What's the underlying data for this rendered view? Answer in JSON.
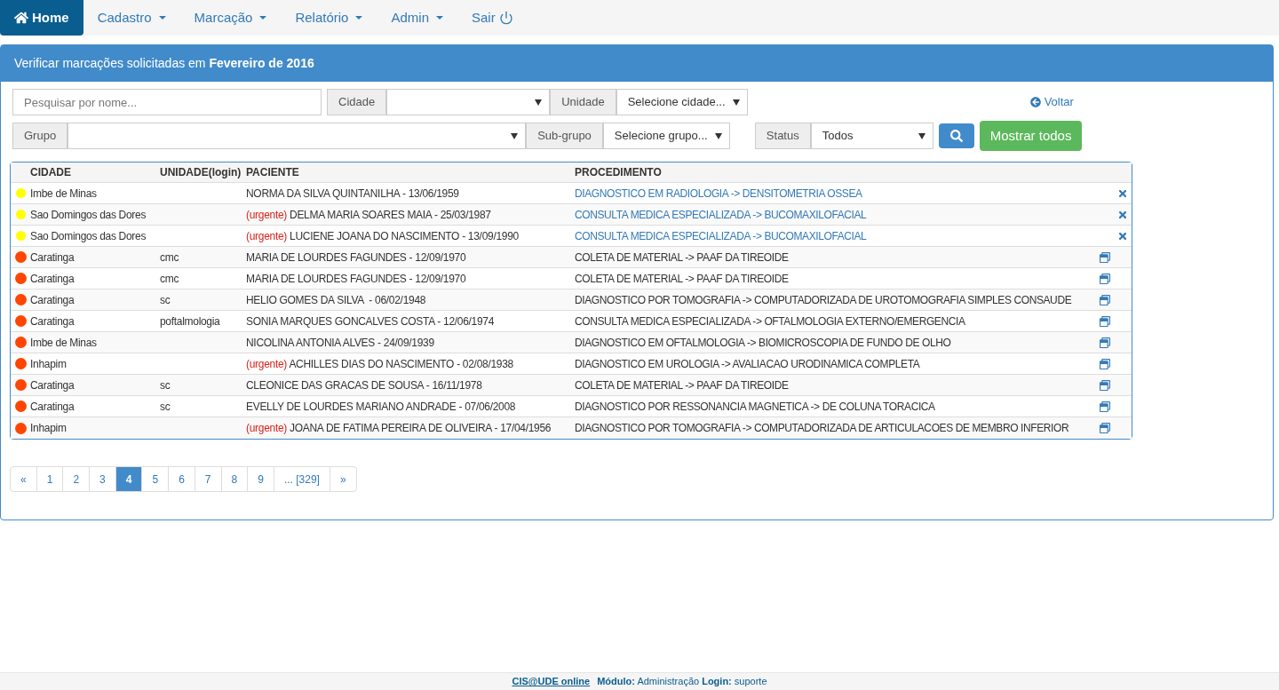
{
  "nav": {
    "items": [
      {
        "label": "Home",
        "kind": "home",
        "selected": true
      },
      {
        "label": "Cadastro",
        "kind": "dropdown",
        "selected": false
      },
      {
        "label": "Marcação",
        "kind": "dropdown",
        "selected": false
      },
      {
        "label": "Relatório",
        "kind": "dropdown",
        "selected": false
      },
      {
        "label": "Admin",
        "kind": "dropdown",
        "selected": false
      },
      {
        "label": "Sair",
        "kind": "logout",
        "selected": false
      }
    ]
  },
  "panel": {
    "title": "Verificar marcações solicitadas em **Fevereiro de 2016**"
  },
  "filters": {
    "search": {
      "placeholder": "Pesquisar por nome..."
    },
    "cidade": {
      "label": "Cidade"
    },
    "unidade": {
      "label": "Unidade",
      "value": "Selecione cidade..."
    },
    "voltar": "Voltar",
    "grupo": {
      "label": "Grupo"
    },
    "subgrupo": {
      "label": "Sub-grupo",
      "value": "Selecione grupo..."
    },
    "status": {
      "label": "Status",
      "value": "Todos"
    },
    "show_all": "Mostrar todos"
  },
  "table": {
    "columns": [
      "CIDADE",
      "UNIDADE(login)",
      "PACIENTE",
      "PROCEDIMENTO"
    ],
    "rows": [
      {
        "kind": "delete",
        "color": "#ffff00",
        "cidade": "Imbe de Minas",
        "paciente": "NORMA DA SILVA QUINTANILHA - 13/06/1959",
        "procedimento": "DIAGNOSTICO EM RADIOLOGIA -> DENSITOMETRIA OSSEA"
      },
      {
        "kind": "delete",
        "color": "#ffff00",
        "cidade": "Sao Domingos das Dores",
        "urgent_tag": "(urgente)",
        "paciente": "DELMA MARIA SOARES MAIA - 25/03/1987",
        "procedimento": "CONSULTA MEDICA ESPECIALIZADA -> BUCOMAXILOFACIAL"
      },
      {
        "kind": "delete",
        "color": "#ffff00",
        "cidade": "Sao Domingos das Dores",
        "urgent_tag": "(urgente)",
        "paciente": "LUCIENE JOANA DO NASCIMENTO - 13/09/1990",
        "procedimento": "CONSULTA MEDICA ESPECIALIZADA -> BUCOMAXILOFACIAL"
      },
      {
        "kind": "open",
        "color": "#ff4500",
        "cidade": "Caratinga",
        "unidade": "cmc",
        "paciente": "MARIA DE LOURDES FAGUNDES - 12/09/1970",
        "procedimento": "COLETA DE MATERIAL -> PAAF DA TIREOIDE"
      },
      {
        "kind": "open",
        "color": "#ff4500",
        "cidade": "Caratinga",
        "unidade": "cmc",
        "paciente": "MARIA DE LOURDES FAGUNDES - 12/09/1970",
        "procedimento": "COLETA DE MATERIAL -> PAAF DA TIREOIDE"
      },
      {
        "kind": "open",
        "color": "#ff4500",
        "cidade": "Caratinga",
        "unidade": "sc",
        "paciente": "HELIO GOMES DA SILVA  - 06/02/1948",
        "procedimento": "DIAGNOSTICO POR TOMOGRAFIA -> COMPUTADORIZADA DE UROTOMOGRAFIA SIMPLES CONSAUDE"
      },
      {
        "kind": "open",
        "color": "#ff4500",
        "cidade": "Caratinga",
        "unidade": "poftalmologia",
        "paciente": "SONIA MARQUES GONCALVES COSTA - 12/06/1974",
        "procedimento": "CONSULTA MEDICA ESPECIALIZADA -> OFTALMOLOGIA EXTERNO/EMERGENCIA"
      },
      {
        "kind": "open",
        "color": "#ff4500",
        "cidade": "Imbe de Minas",
        "paciente": "NICOLINA ANTONIA ALVES - 24/09/1939",
        "procedimento": "DIAGNOSTICO EM OFTALMOLOGIA -> BIOMICROSCOPIA DE FUNDO DE OLHO"
      },
      {
        "kind": "open",
        "color": "#ff4500",
        "cidade": "Inhapim",
        "urgent_tag": "(urgente)",
        "paciente": "ACHILLES DIAS DO NASCIMENTO - 02/08/1938",
        "procedimento": "DIAGNOSTICO EM UROLOGIA -> AVALIACAO URODINAMICA COMPLETA"
      },
      {
        "kind": "open",
        "color": "#ff4500",
        "cidade": "Caratinga",
        "unidade": "sc",
        "paciente": "CLEONICE DAS GRACAS DE SOUSA - 16/11/1978",
        "procedimento": "COLETA DE MATERIAL -> PAAF DA TIREOIDE"
      },
      {
        "kind": "open",
        "color": "#ff4500",
        "cidade": "Caratinga",
        "unidade": "sc",
        "paciente": "EVELLY DE LOURDES MARIANO ANDRADE - 07/06/2008",
        "procedimento": "DIAGNOSTICO POR RESSONANCIA MAGNETICA -> DE COLUNA TORACICA"
      },
      {
        "kind": "open",
        "color": "#ff4500",
        "cidade": "Inhapim",
        "urgent_tag": "(urgente)",
        "paciente": "JOANA DE FATIMA PEREIRA DE OLIVEIRA - 17/04/1956",
        "procedimento": "DIAGNOSTICO POR TOMOGRAFIA -> COMPUTADORIZADA DE ARTICULACOES DE MEMBRO INFERIOR"
      }
    ]
  },
  "pagination": [
    {
      "label": "«",
      "selected": false
    },
    {
      "label": "1",
      "selected": false
    },
    {
      "label": "2",
      "selected": false
    },
    {
      "label": "3",
      "selected": false
    },
    {
      "label": "4",
      "selected": true
    },
    {
      "label": "5",
      "selected": false
    },
    {
      "label": "6",
      "selected": false
    },
    {
      "label": "7",
      "selected": false
    },
    {
      "label": "8",
      "selected": false
    },
    {
      "label": "9",
      "selected": false
    },
    {
      "label": "... [329]",
      "selected": false
    },
    {
      "label": "»",
      "selected": false
    }
  ],
  "footer": {
    "link": "CIS@UDE online",
    "info": "**Módulo:** Administração **Login:** suporte"
  }
}
